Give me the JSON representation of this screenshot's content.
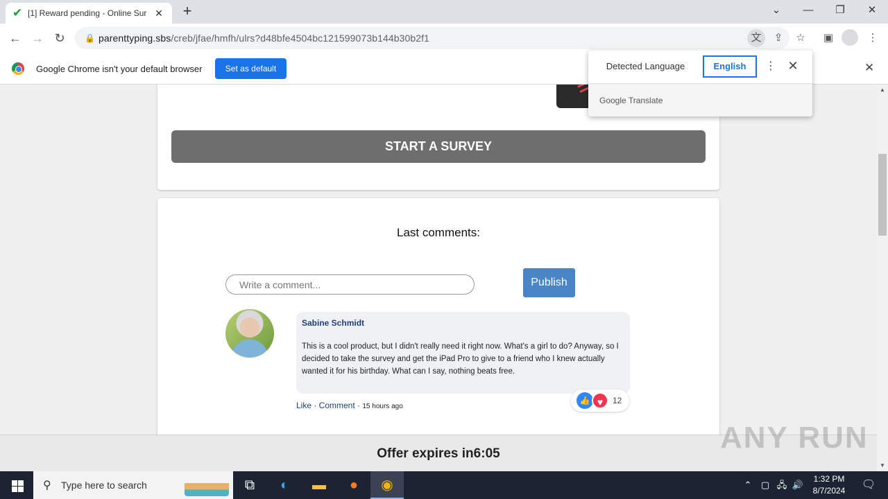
{
  "browser": {
    "tab_title": "[1] Reward pending - Online Sur",
    "url_host": "parenttyping.sbs",
    "url_path": "/creb/jfae/hmfh/ulrs?d48bfe4504bc121599073b144b30b2f1"
  },
  "infobar": {
    "message": "Google Chrome isn't your default browser",
    "set_default_label": "Set as default"
  },
  "translate": {
    "detected_label": "Detected Language",
    "target_label": "English",
    "footer": "Google Translate"
  },
  "survey": {
    "start_label": "START A SURVEY"
  },
  "comments": {
    "title": "Last comments:",
    "input_placeholder": "Write a comment...",
    "publish_label": "Publish",
    "items": [
      {
        "author": "Sabine Schmidt",
        "text": "This is a cool product, but I didn't really need it right now. What's a girl to do? Anyway, so I decided to take the survey and get the iPad Pro to give to a friend who I knew actually wanted it for his birthday. What can I say, nothing beats free.",
        "actions": "Like · Comment ·",
        "time": "15 hours ago",
        "reaction_count": "12"
      }
    ]
  },
  "offer": {
    "label": "Offer expires in",
    "timer": "6:05"
  },
  "watermark": "ANY RUN",
  "taskbar": {
    "search_placeholder": "Type here to search",
    "time": "1:32 PM",
    "date": "8/7/2024"
  }
}
